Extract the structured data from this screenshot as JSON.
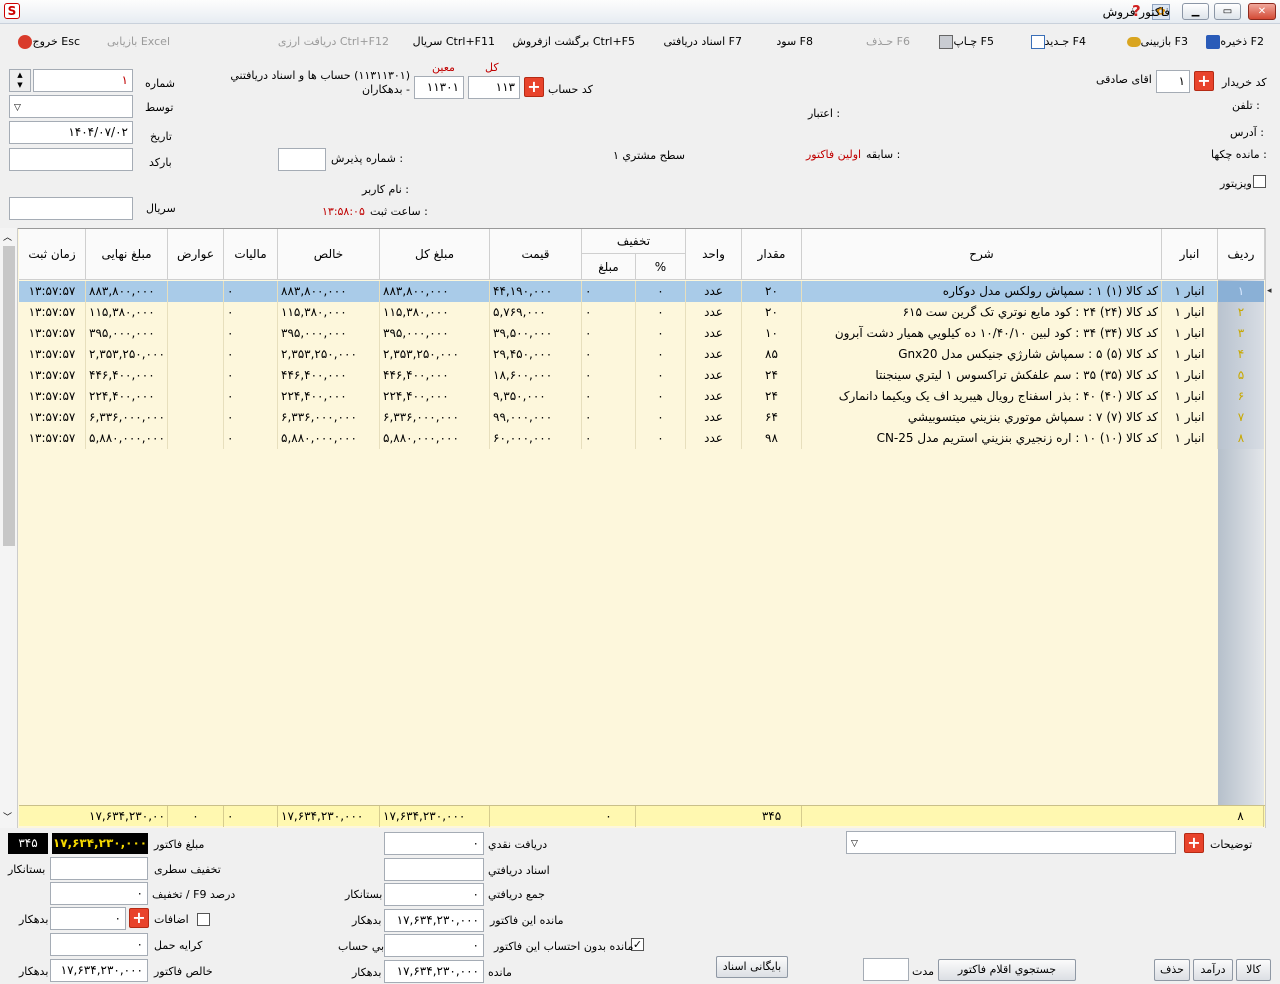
{
  "window": {
    "title": "فاکتور فروش"
  },
  "toolbar": {
    "save": "ذخیره F2",
    "search": "بازبینی F3",
    "new": "جـدید F4",
    "print": "چـاپ F5",
    "delete": "حـذف F6",
    "profit": "سود F8",
    "received_docs": "اسناد دریافتی F7",
    "return": "برگشت ازفروش Ctrl+F5",
    "serial": "سریال Ctrl+F11",
    "currency": "دریافت ارزی Ctrl+F12",
    "excel": "بازیابی Excel",
    "exit": "خروج Esc"
  },
  "header": {
    "number_label": "شماره",
    "number_value": "۱",
    "by_label": "توسط",
    "date_label": "تاریخ",
    "date_value": "۱۴۰۴/۰۷/۰۲",
    "barcode_label": "بارکد",
    "serial_label": "سریال",
    "buyer_label": "کد خریدار",
    "buyer_code": "۱",
    "buyer_name": "اقای  صادقی",
    "phone_label": "تلفن :",
    "credit_label": "اعتبار :",
    "address_label": "آدرس :",
    "checks_label": "مانده چکها :",
    "history_label": "سابقه :",
    "history_value": "اولین فاکتور",
    "level_label": "سطح مشتري ۱",
    "visitor_label": "ویزیتور",
    "account_label": "کد حساب",
    "kol_label": "کل",
    "moein_label": "معین",
    "kol_value": "۱۱۳",
    "moein_value": "۱۱۳۰۱",
    "account_desc": "(۱۱۳۱۱۳۰۱) حساب ها و اسناد دریافتني - بدهکاران",
    "reception_label": "شماره پذیرش :",
    "user_label": "نام کاربر :",
    "time_label": "ساعت ثبت :",
    "time_value": "۱۳:۵۸:۰۵"
  },
  "grid": {
    "columns": {
      "row": "ردیف",
      "warehouse": "انبار",
      "desc": "شرح",
      "qty": "مقدار",
      "unit": "واحد",
      "discount": "تخفیف",
      "percent": "%",
      "amount": "مبلغ",
      "price": "قیمت",
      "total": "مبلغ کل",
      "net": "خالص",
      "tax": "مالیات",
      "duties": "عوارض",
      "final": "مبلغ نهایی",
      "time": "زمان ثبت"
    },
    "rows": [
      {
        "row": "۱",
        "warehouse": "انبار ۱",
        "desc": "کد کالا (۱) ۱ : سمپاش رولکس مدل دوکاره",
        "qty": "۲۰",
        "unit": "عدد",
        "percent": "۰",
        "amount": "۰",
        "price": "۴۴,۱۹۰,۰۰۰",
        "total": "۸۸۳,۸۰۰,۰۰۰",
        "net": "۸۸۳,۸۰۰,۰۰۰",
        "tax": "۰",
        "duties": "",
        "final": "۸۸۳,۸۰۰,۰۰۰",
        "time": "۱۳:۵۷:۵۷"
      },
      {
        "row": "۲",
        "warehouse": "انبار ۱",
        "desc": "کد کالا (۲۴) ۲۴ : کود مایع نوتري تک گرین ست ۶۱۵",
        "qty": "۲۰",
        "unit": "عدد",
        "percent": "۰",
        "amount": "۰",
        "price": "۵,۷۶۹,۰۰۰",
        "total": "۱۱۵,۳۸۰,۰۰۰",
        "net": "۱۱۵,۳۸۰,۰۰۰",
        "tax": "۰",
        "duties": "",
        "final": "۱۱۵,۳۸۰,۰۰۰",
        "time": "۱۳:۵۷:۵۷"
      },
      {
        "row": "۳",
        "warehouse": "انبار ۱",
        "desc": "کد کالا (۳۴) ۳۴ : کود لبین ۱۰/۴۰/۱۰ ده کیلویي همیار دشت آبرون",
        "qty": "۱۰",
        "unit": "عدد",
        "percent": "۰",
        "amount": "۰",
        "price": "۳۹,۵۰۰,۰۰۰",
        "total": "۳۹۵,۰۰۰,۰۰۰",
        "net": "۳۹۵,۰۰۰,۰۰۰",
        "tax": "۰",
        "duties": "",
        "final": "۳۹۵,۰۰۰,۰۰۰",
        "time": "۱۳:۵۷:۵۷"
      },
      {
        "row": "۴",
        "warehouse": "انبار ۱",
        "desc": "کد کالا (۵) ۵ : سمپاش شارژي جنیکس مدل Gnx20",
        "qty": "۸۵",
        "unit": "عدد",
        "percent": "۰",
        "amount": "۰",
        "price": "۲۹,۴۵۰,۰۰۰",
        "total": "۲,۳۵۳,۲۵۰,۰۰۰",
        "net": "۲,۳۵۳,۲۵۰,۰۰۰",
        "tax": "۰",
        "duties": "",
        "final": "۲,۳۵۳,۲۵۰,۰۰۰",
        "time": "۱۳:۵۷:۵۷"
      },
      {
        "row": "۵",
        "warehouse": "انبار ۱",
        "desc": "کد کالا (۳۵) ۳۵ : سم علفکش تراکسوس ۱ لیتري سینجنتا",
        "qty": "۲۴",
        "unit": "عدد",
        "percent": "۰",
        "amount": "۰",
        "price": "۱۸,۶۰۰,۰۰۰",
        "total": "۴۴۶,۴۰۰,۰۰۰",
        "net": "۴۴۶,۴۰۰,۰۰۰",
        "tax": "۰",
        "duties": "",
        "final": "۴۴۶,۴۰۰,۰۰۰",
        "time": "۱۳:۵۷:۵۷"
      },
      {
        "row": "۶",
        "warehouse": "انبار ۱",
        "desc": "کد کالا (۴۰) ۴۰ : بذر اسفناج رویال هیبرید اف یک ویکیما دانمارک",
        "qty": "۲۴",
        "unit": "عدد",
        "percent": "۰",
        "amount": "۰",
        "price": "۹,۳۵۰,۰۰۰",
        "total": "۲۲۴,۴۰۰,۰۰۰",
        "net": "۲۲۴,۴۰۰,۰۰۰",
        "tax": "۰",
        "duties": "",
        "final": "۲۲۴,۴۰۰,۰۰۰",
        "time": "۱۳:۵۷:۵۷"
      },
      {
        "row": "۷",
        "warehouse": "انبار ۱",
        "desc": "کد کالا (۷) ۷ : سمپاش موتوري بنزیني میتسوبیشي",
        "qty": "۶۴",
        "unit": "عدد",
        "percent": "۰",
        "amount": "۰",
        "price": "۹۹,۰۰۰,۰۰۰",
        "total": "۶,۳۳۶,۰۰۰,۰۰۰",
        "net": "۶,۳۳۶,۰۰۰,۰۰۰",
        "tax": "۰",
        "duties": "",
        "final": "۶,۳۳۶,۰۰۰,۰۰۰",
        "time": "۱۳:۵۷:۵۷"
      },
      {
        "row": "۸",
        "warehouse": "انبار ۱",
        "desc": "کد کالا (۱۰) ۱۰ : اره زنجیري بنزیني استریم مدل CN-25",
        "qty": "۹۸",
        "unit": "عدد",
        "percent": "۰",
        "amount": "۰",
        "price": "۶۰,۰۰۰,۰۰۰",
        "total": "۵,۸۸۰,۰۰۰,۰۰۰",
        "net": "۵,۸۸۰,۰۰۰,۰۰۰",
        "tax": "۰",
        "duties": "",
        "final": "۵,۸۸۰,۰۰۰,۰۰۰",
        "time": "۱۳:۵۷:۵۷"
      }
    ],
    "footer": {
      "count": "۸",
      "qty": "۳۴۵",
      "amount": "۰",
      "total": "۱۷,۶۳۴,۲۳۰,۰۰۰",
      "net": "۱۷,۶۳۴,۲۳۰,۰۰۰",
      "tax": "۰",
      "duties": "۰",
      "final": "۱۷,۶۳۴,۲۳۰,۰۰۰"
    }
  },
  "bottom": {
    "invoice_amount_label": "مبلغ فاکتور",
    "invoice_amount": "۱۷,۶۳۴,۲۳۰,۰۰۰",
    "invoice_count": "۳۴۵",
    "row_discount_label": "تخفیف سطری",
    "creditor": "بستانکار",
    "discount_label": "تخفیف / F9 درصد",
    "discount_value": "۰",
    "additions_label": "اضافات",
    "additions_value": "۰",
    "debtor": "بدهکار",
    "freight_label": "کرایه حمل",
    "freight_value": "۰",
    "net_invoice_label": "خالص فاکتور",
    "net_invoice_value": "۱۷,۶۳۴,۲۳۰,۰۰۰",
    "cash_label": "دریافت نقدي",
    "cash_value": "۰",
    "recv_docs_label": "اسناد دریافتي",
    "recv_sum_label": "جمع دریافتي",
    "recv_sum_value": "۰",
    "remain_invoice_label": "مانده این فاکتور",
    "remain_invoice_value": "۱۷,۶۳۴,۲۳۰,۰۰۰",
    "remain_excl_label": "مانده بدون احتساب این فاکتور",
    "remain_excl_value": "۰",
    "nobal": "بي حساب",
    "remain_label": "مانده",
    "remain_value": "۱۷,۶۳۴,۲۳۰,۰۰۰",
    "notes_label": "توضیحات",
    "archive_btn": "بایگانی اسناد",
    "duration_label": "مدت",
    "search_items_btn": "جستجوي اقلام فاکتور Ctrl+F",
    "goods_btn": "کالا",
    "income_btn": "درآمد",
    "delete_btn": "حذف"
  }
}
